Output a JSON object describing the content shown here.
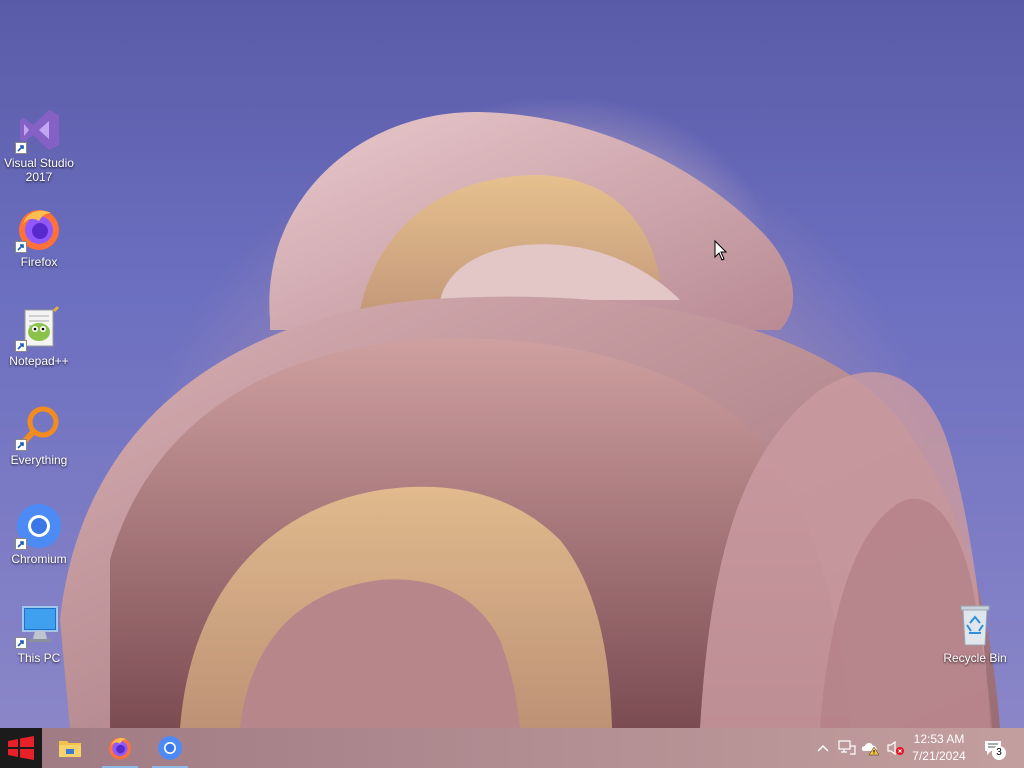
{
  "desktop": {
    "icons": [
      {
        "label": "Visual Studio\n2017",
        "icon": "visual-studio-icon"
      },
      {
        "label": "Firefox",
        "icon": "firefox-icon"
      },
      {
        "label": "Notepad++",
        "icon": "notepad-plus-plus-icon"
      },
      {
        "label": "Everything",
        "icon": "everything-search-icon"
      },
      {
        "label": "Chromium",
        "icon": "chromium-icon"
      },
      {
        "label": "This PC",
        "icon": "this-pc-icon"
      },
      {
        "label": "Recycle Bin",
        "icon": "recycle-bin-icon"
      }
    ]
  },
  "taskbar": {
    "pinned": [
      "file-explorer-icon",
      "firefox-icon",
      "chromium-icon"
    ],
    "tray_icons": [
      "chevron-up-icon",
      "network-icon",
      "onedrive-warning-icon",
      "volume-muted-icon"
    ],
    "clock": {
      "time": "12:53 AM",
      "date": "7/21/2024"
    },
    "notifications_count": "3"
  },
  "colors": {
    "start_bg": "#1b1b1b",
    "start_logo": "#e8202a",
    "accent_underline": "#8fb8e8"
  }
}
